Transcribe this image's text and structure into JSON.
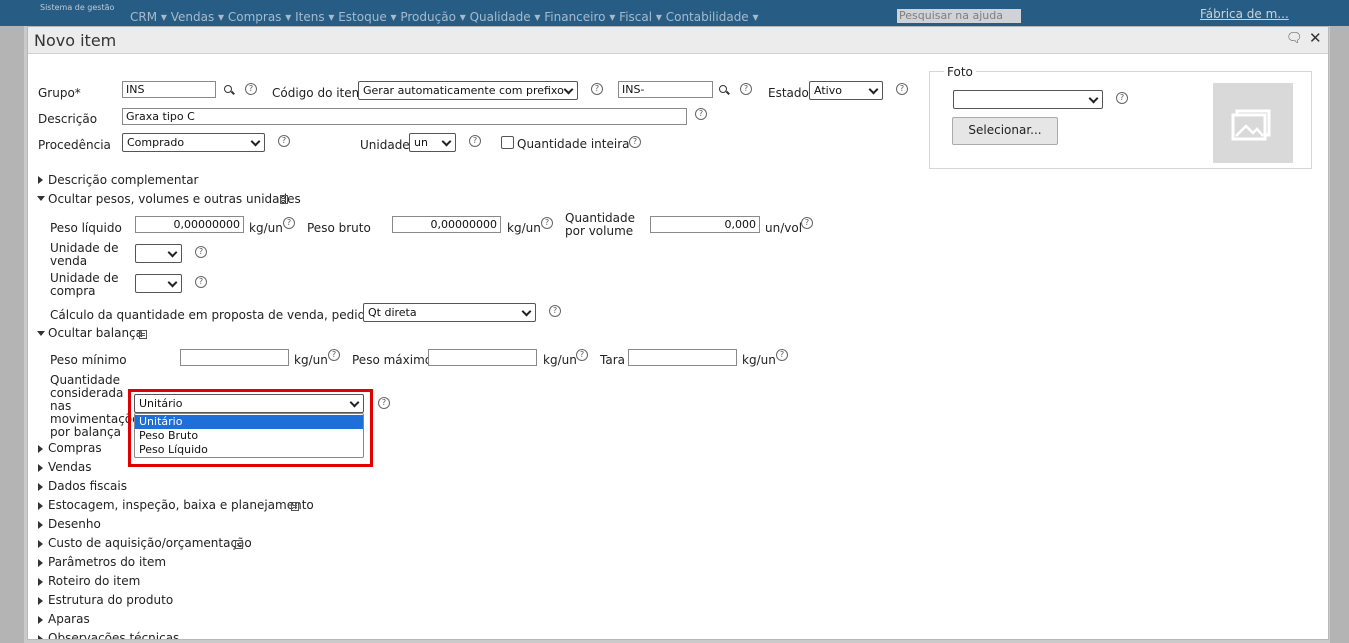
{
  "app": {
    "brand": "Sistema de gestão",
    "menu": "CRM ▾  Vendas ▾  Compras ▾  Itens ▾  Estoque ▾  Produção ▾  Qualidade ▾  Financeiro ▾  Fiscal ▾  Contabilidade ▾",
    "help_placeholder": "Pesquisar na ajuda",
    "company": "Fábrica de m..."
  },
  "dialog": {
    "title": "Novo item"
  },
  "form": {
    "grupo_label": "Grupo*",
    "grupo_value": "INS",
    "codigo_label": "Código do item",
    "codigo_option": "Gerar automaticamente com prefixo",
    "codigo_prefix": "INS-",
    "estado_label": "Estado",
    "estado_value": "Ativo",
    "descricao_label": "Descrição",
    "descricao_value": "Graxa tipo C",
    "procedencia_label": "Procedência",
    "procedencia_value": "Comprado",
    "unidade_label": "Unidade",
    "unidade_value": "un",
    "qtd_inteira_label": "Quantidade inteira"
  },
  "foto": {
    "legend": "Foto",
    "select_button": "Selecionar..."
  },
  "sections": {
    "descricao_complementar": "Descrição complementar",
    "pesos": "Ocultar pesos, volumes e outras unidades",
    "balanca": "Ocultar balança"
  },
  "pesos": {
    "peso_liquido_label": "Peso líquido",
    "peso_liquido_value": "0,00000000",
    "peso_liquido_unit": "kg/un",
    "peso_bruto_label": "Peso bruto",
    "peso_bruto_value": "0,00000000",
    "peso_bruto_unit": "kg/un",
    "qtd_volume_label_1": "Quantidade",
    "qtd_volume_label_2": "por volume",
    "qtd_volume_value": "0,000",
    "qtd_volume_unit": "un/vol",
    "unidade_venda_1": "Unidade de",
    "unidade_venda_2": "venda",
    "unidade_compra_1": "Unidade de",
    "unidade_compra_2": "compra",
    "calculo_label": "Cálculo da quantidade em proposta de venda, pedido, NF",
    "calculo_value": "Qt direta"
  },
  "balanca": {
    "peso_minimo_label": "Peso mínimo",
    "peso_minimo_unit": "kg/un",
    "peso_maximo_label": "Peso máximo",
    "peso_maximo_unit": "kg/un",
    "tara_label": "Tara",
    "tara_unit": "kg/un",
    "qtd_label_lines": [
      "Quantidade",
      "considerada",
      "nas",
      "movimentações",
      "por balança"
    ],
    "qtd_selected": "Unitário",
    "qtd_options": [
      "Unitário",
      "Peso Bruto",
      "Peso Líquido"
    ]
  },
  "collapsed_sections": [
    "Compras",
    "Vendas",
    "Dados fiscais",
    "Estocagem, inspeção, baixa e planejamento",
    "Desenho",
    "Custo de aquisição/orçamentação",
    "Parâmetros do item",
    "Roteiro do item",
    "Estrutura do produto",
    "Aparas",
    "Observações técnicas"
  ],
  "icons": {
    "help": "help-circle-icon",
    "search": "magnifier-icon",
    "note": "note-icon",
    "photo": "photo-placeholder-icon"
  }
}
